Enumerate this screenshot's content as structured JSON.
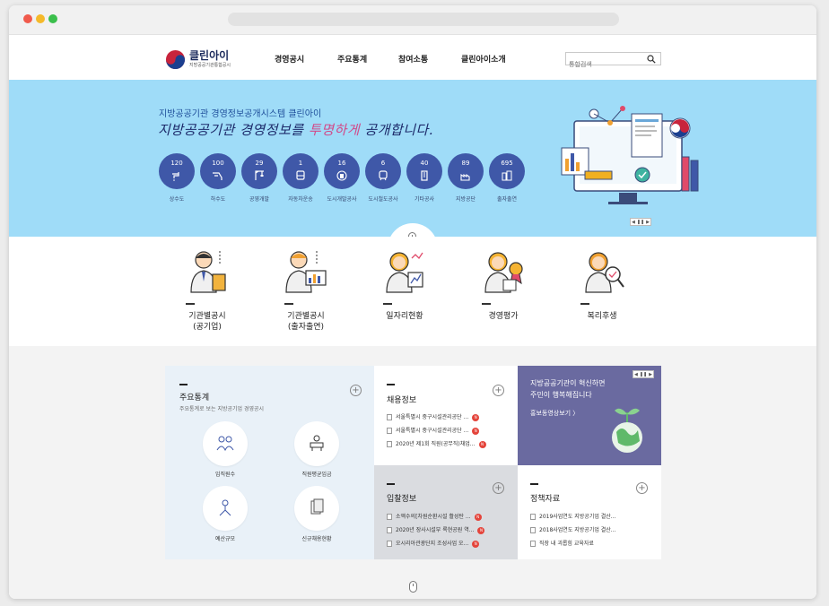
{
  "header": {
    "logo_title": "클린아이",
    "logo_sub": "지방공공기관통합공시",
    "nav": [
      "경영공시",
      "주요통계",
      "참여소통",
      "클린아이소개"
    ],
    "search_placeholder": "통합검색"
  },
  "hero": {
    "title": "지방공공기관 경영정보공개시스템 클린아이",
    "slogan_pre": "지방공공기관 경영정보를 ",
    "slogan_hl": "투명하게",
    "slogan_post": " 공개합니다.",
    "stats": [
      {
        "count": "120",
        "label": "상수도",
        "icon": "faucet-icon"
      },
      {
        "count": "100",
        "label": "하수도",
        "icon": "drain-icon"
      },
      {
        "count": "29",
        "label": "공영개발",
        "icon": "crane-icon"
      },
      {
        "count": "1",
        "label": "자동차운송",
        "icon": "bus-icon"
      },
      {
        "count": "16",
        "label": "도시개발공사",
        "icon": "city-icon"
      },
      {
        "count": "6",
        "label": "도시철도공사",
        "icon": "train-icon"
      },
      {
        "count": "40",
        "label": "기타공사",
        "icon": "building-icon"
      },
      {
        "count": "89",
        "label": "지방공단",
        "icon": "factory-icon"
      },
      {
        "count": "695",
        "label": "출자출연",
        "icon": "office-icon"
      }
    ],
    "slider_prev": "◀",
    "slider_pause": "❚❚",
    "slider_next": "▶"
  },
  "quick_menu": [
    {
      "line1": "기관별공시",
      "line2": "(공기업)"
    },
    {
      "line1": "기관별공시",
      "line2": "(출자출연)"
    },
    {
      "line1": "일자리현황",
      "line2": ""
    },
    {
      "line1": "경영평가",
      "line2": ""
    },
    {
      "line1": "복리후생",
      "line2": ""
    }
  ],
  "stats_panel": {
    "title": "주요통계",
    "subtitle": "주요통계로 보는 지방공기업 경영공시",
    "plus": "+",
    "items": [
      "임직원수",
      "직원평균임금",
      "예산규모",
      "신규채용현황"
    ]
  },
  "jobs_panel": {
    "title": "채용정보",
    "plus": "+",
    "items": [
      "서울특별시 중구시설관리공단 ...",
      "서울특별시 중구시설관리공단 ...",
      "2020년 제1회 직원(공무직)채업..."
    ],
    "new_badge": "N"
  },
  "promo_panel": {
    "line1": "지방공공기관이 혁신하면",
    "line2": "주민이 행복해집니다",
    "link": "홍보동영상보기 〉",
    "color": "#6a6aa0"
  },
  "bid_panel": {
    "title": "입찰정보",
    "plus": "+",
    "items": [
      "소액수의[차원순환시설 활성탄 ...",
      "2020년 장사시설부 록현공원 역...",
      "오시리아관광단지 조성사업 오..."
    ],
    "new_badge": "N"
  },
  "policy_panel": {
    "title": "정책자료",
    "plus": "+",
    "items": [
      "2019사업연도 지방공기업 결산...",
      "2018사업연도 지방공기업 결산...",
      "직장 내 괴롭힘 교육자료"
    ]
  }
}
